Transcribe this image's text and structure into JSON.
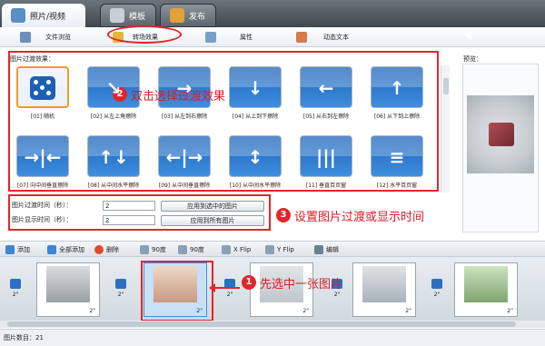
{
  "tabs": [
    {
      "label": "照片/视频",
      "active": true
    },
    {
      "label": "模板",
      "active": false
    },
    {
      "label": "发布",
      "active": false
    }
  ],
  "subnav": [
    {
      "label": "文件浏览"
    },
    {
      "label": "转场效果"
    },
    {
      "label": "属性"
    },
    {
      "label": "动态文本"
    }
  ],
  "effects_label": "图片过渡效果：",
  "effects": [
    {
      "name": "[01] 随机",
      "glyph": "dice"
    },
    {
      "name": "[02] 从左上角擦除",
      "glyph": "↘"
    },
    {
      "name": "[03] 从左到右擦除",
      "glyph": "→"
    },
    {
      "name": "[04] 从上到下擦除",
      "glyph": "↓"
    },
    {
      "name": "[05] 从右到左擦除",
      "glyph": "←"
    },
    {
      "name": "[06] 从下到上擦除",
      "glyph": "↑"
    },
    {
      "name": "[07] 向中间垂直擦除",
      "glyph": "→|←"
    },
    {
      "name": "[08] 从中间水平擦除",
      "glyph": "↑↓"
    },
    {
      "name": "[09] 从中间垂直擦除",
      "glyph": "←|→"
    },
    {
      "name": "[10] 从中间水平擦除",
      "glyph": "↕"
    },
    {
      "name": "[11] 垂直百页窗",
      "glyph": "|||"
    },
    {
      "name": "[12] 水平百页窗",
      "glyph": "≡"
    }
  ],
  "annotations": {
    "step2": "双击选择过渡效果",
    "step3": "设置图片过渡或显示时间",
    "step1": "先选中一张图片",
    "num1": "1",
    "num2": "2",
    "num3": "3"
  },
  "preview_label": "预览：",
  "timing": {
    "transition_label": "图片过渡时间（秒）：",
    "transition_value": "2",
    "transition_apply": "应用到选中的图片",
    "display_label": "图片显示时间（秒）：",
    "display_value": "2",
    "display_apply": "应用到所有图片"
  },
  "toolbar": {
    "add": "添加",
    "add_all": "全部添加",
    "delete": "删除",
    "rot_left": "90度",
    "rot_right": "90度",
    "xflip": "X Flip",
    "yflip": "Y Flip",
    "edit": "编辑"
  },
  "strip": {
    "frames": [
      {
        "dur": "2\"",
        "label": ""
      },
      {
        "dur": "2\"",
        "label": ""
      },
      {
        "dur": "2\"",
        "label": ""
      },
      {
        "dur": "2\"",
        "label": ""
      },
      {
        "dur": "2\"",
        "label": ""
      }
    ],
    "transitions": [
      "2\"",
      "2\"",
      "2\"",
      "2\"",
      "2\""
    ]
  },
  "status": "图片数目：21",
  "colors": {
    "accent_red": "#e0262b",
    "tile_blue": "#1d64b8"
  }
}
